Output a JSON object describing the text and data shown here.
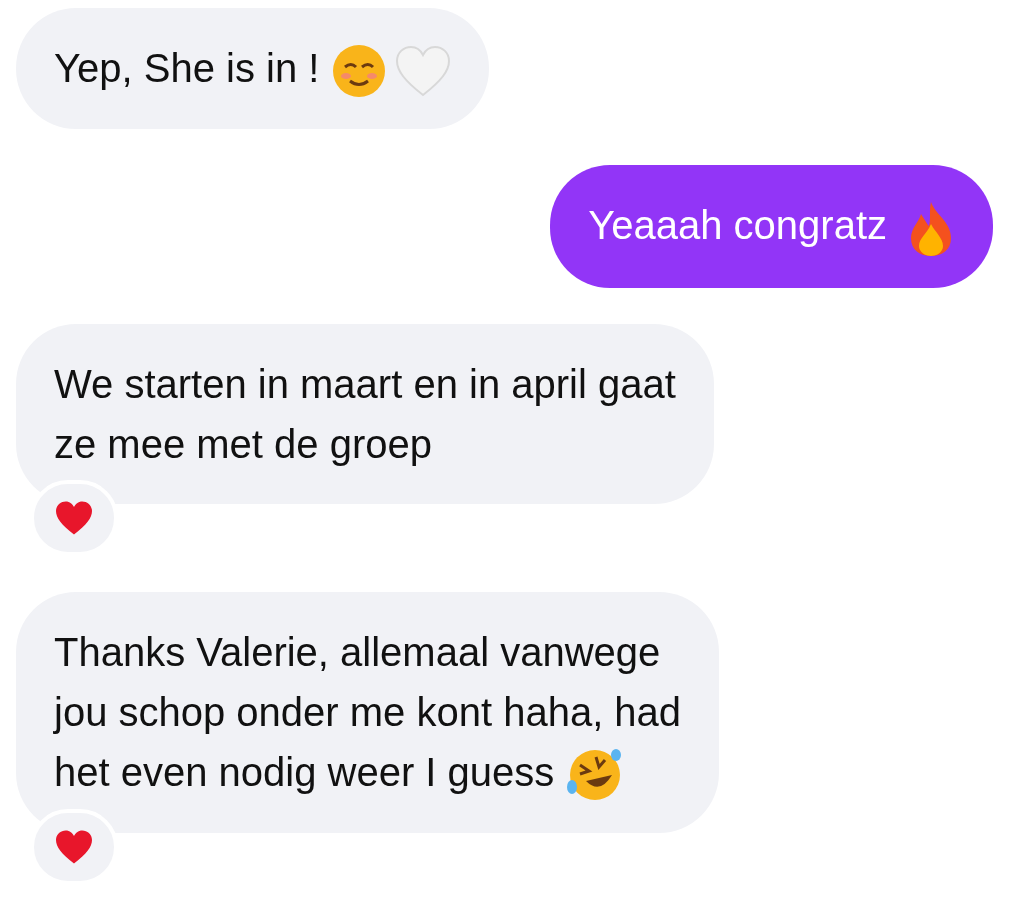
{
  "messages": [
    {
      "kind": "incoming",
      "lines": [
        "Yep, She is in !"
      ],
      "emoji": [
        {
          "kind": "smile"
        },
        {
          "kind": "white_heart"
        }
      ],
      "reacted": false
    },
    {
      "kind": "outgoing",
      "lines": [
        "Yeaaah congratz"
      ],
      "emoji": [
        {
          "kind": "fire"
        }
      ],
      "reacted": false
    },
    {
      "kind": "incoming",
      "lines": [
        "We starten in maart en in april gaat",
        "ze mee met de groep"
      ],
      "reacted": true
    },
    {
      "kind": "incoming",
      "lines": [
        "Thanks Valerie, allemaal vanwege",
        "jou schop onder me kont haha, had",
        "het even nodig weer I guess"
      ],
      "emoji": [
        {
          "kind": "laugh"
        }
      ],
      "reacted": true
    }
  ]
}
